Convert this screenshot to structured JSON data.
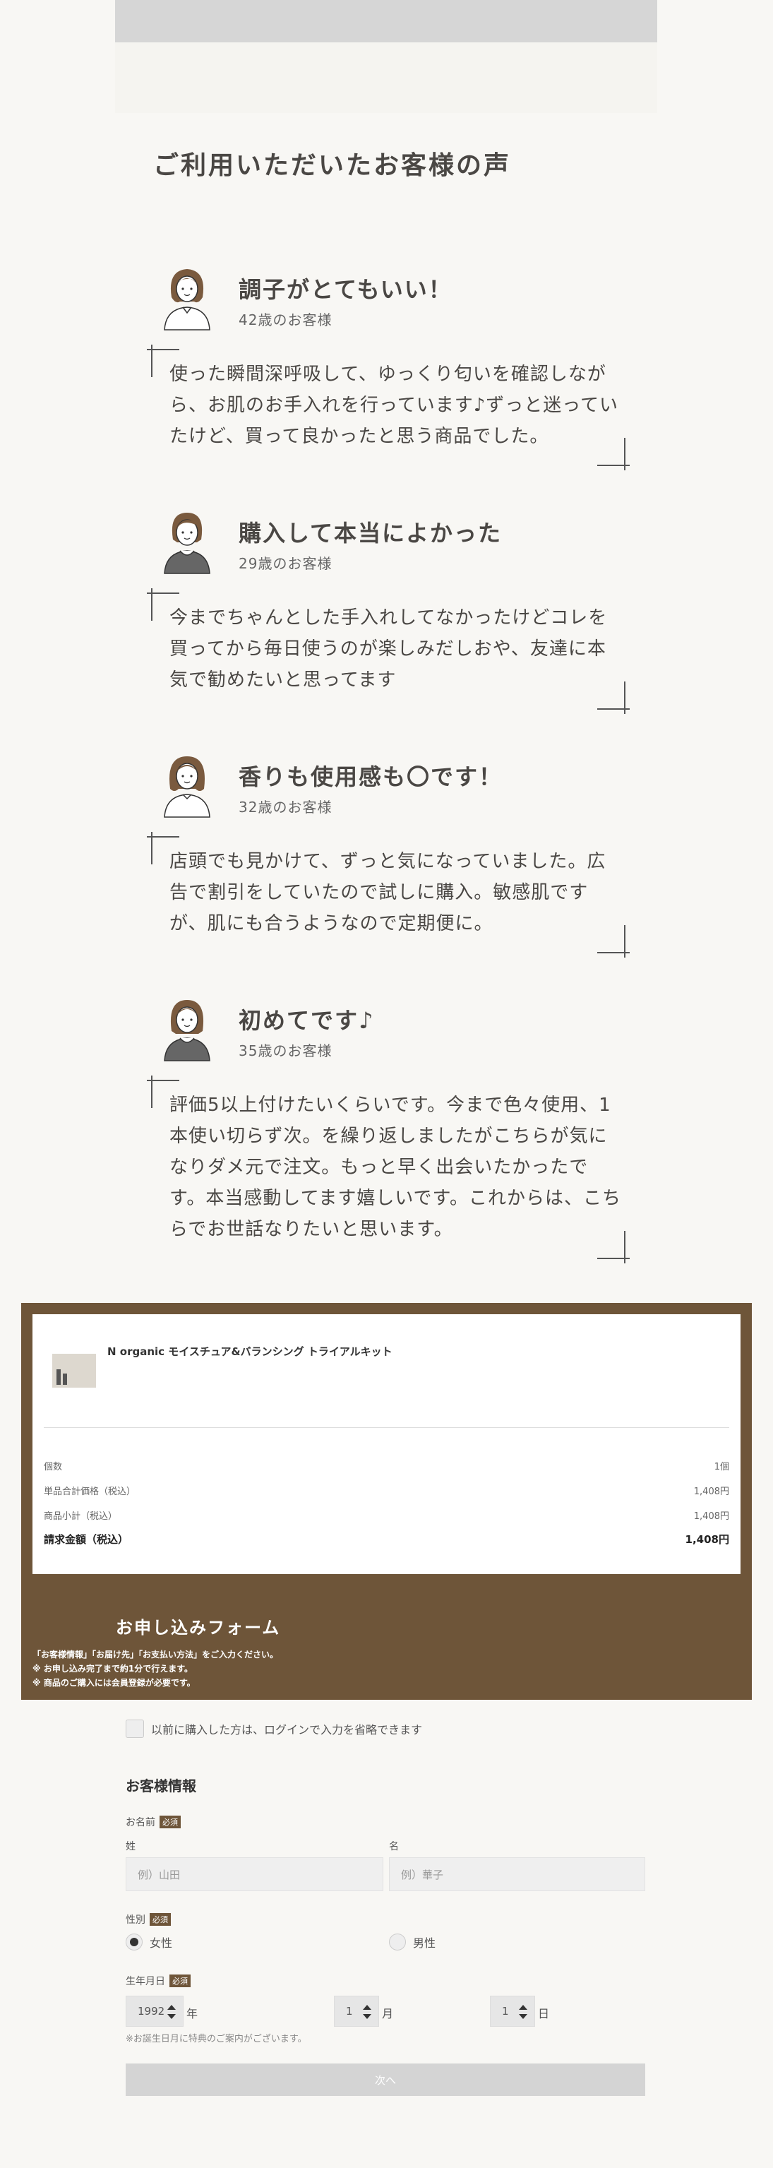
{
  "voices": {
    "title": "ご利用いただいたお客様の声",
    "reviews": [
      {
        "title": "調子がとてもいい！",
        "age": "42歳のお客様",
        "text": "使った瞬間深呼吸して、ゆっくり匂いを確認しながら、お肌のお手入れを行っています♪ずっと迷っていたけど、買って良かったと思う商品でした。"
      },
      {
        "title": "購入して本当によかった",
        "age": "29歳のお客様",
        "text": "今までちゃんとした手入れしてなかったけどコレを買ってから毎日使うのが楽しみだしおや、友達に本気で勧めたいと思ってます"
      },
      {
        "title": "香りも使用感も〇です！",
        "age": "32歳のお客様",
        "text": "店頭でも見かけて、ずっと気になっていました。広告で割引をしていたので試しに購入。敏感肌ですが、肌にも合うようなので定期便に。"
      },
      {
        "title": "初めてです♪",
        "age": "35歳のお客様",
        "text": "評価5以上付けたいくらいです。今まで色々使用、1本使い切らず次。を繰り返しましたがこちらが気になりダメ元で注文。もっと早く出会いたかったです。本当感動してます嬉しいです。これからは、こちらでお世話なりたいと思います。"
      }
    ]
  },
  "order": {
    "product_name": "N organic モイスチュア&バランシング トライアルキット",
    "rows": [
      {
        "label": "個数",
        "value": "1個"
      },
      {
        "label": "単品合計価格（税込）",
        "value": "1,408円"
      },
      {
        "label": "商品小計（税込）",
        "value": "1,408円"
      },
      {
        "label": "請求金額（税込）",
        "value": "1,408円"
      }
    ],
    "form_heading": "お申し込みフォーム",
    "notes": [
      "「お客様情報」「お届け先」「お支払い方法」をご入力ください。",
      "※ お申し込み完了まで約1分で行えます。",
      "※ 商品のご購入には会員登録が必要です。"
    ]
  },
  "form": {
    "login_text": "以前に購入した方は、ログインで入力を省略できます",
    "section_title": "お客様情報",
    "required_badge": "必須",
    "name_label": "お名前",
    "last_name_label": "姓",
    "first_name_label": "名",
    "last_name_placeholder": "例）山田",
    "first_name_placeholder": "例）華子",
    "gender_label": "性別",
    "gender_female": "女性",
    "gender_male": "男性",
    "birthday_label": "生年月日",
    "year_value": "1992",
    "year_unit": "年",
    "month_value": "1",
    "month_unit": "月",
    "day_value": "1",
    "day_unit": "日",
    "birthday_note": "※お誕生日月に特典のご案内がございます。",
    "next_button": "次へ"
  },
  "colors": {
    "brand_brown": "#6e5539",
    "page_bg": "#f8f7f4"
  }
}
